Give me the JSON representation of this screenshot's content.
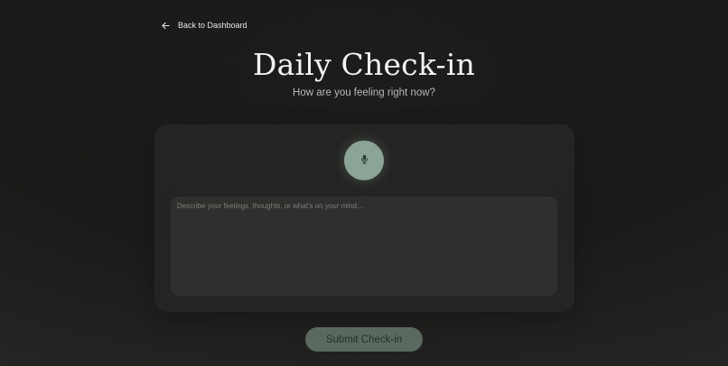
{
  "nav": {
    "back_label": "Back to Dashboard",
    "back_icon": "arrow-left-icon"
  },
  "header": {
    "title": "Daily Check-in",
    "subtitle": "How are you feeling right now?"
  },
  "checkin_card": {
    "mic_icon": "microphone-icon",
    "entry_placeholder": "Describe your feelings, thoughts, or what's on your mind...",
    "entry_value": ""
  },
  "actions": {
    "submit_label": "Submit Check-in"
  },
  "colors": {
    "accent": "#8aa595",
    "submit_bg": "#5e6e64",
    "background": "#1a1a19",
    "card_bg": "#262625",
    "input_bg": "#2f2f2d"
  }
}
